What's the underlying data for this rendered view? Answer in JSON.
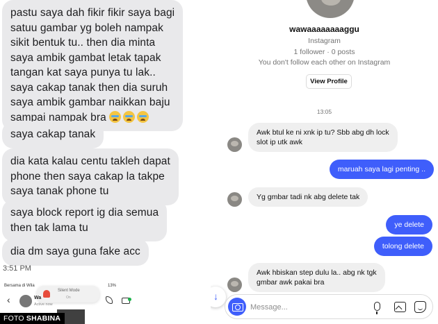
{
  "left_chat": {
    "bubbles": [
      {
        "lines": [
          "pastu saya dah fikir fikir saya bagi",
          "satuu gambar yg boleh nampak",
          "sikit bentuk tu.. then dia minta",
          "saya ambik gambat letak tapak",
          "tangan kat saya punya tu lak..",
          "saya cakap tanak then dia suruh",
          "saya ambik gambar naikkan baju",
          "sampai nampak bra"
        ]
      },
      {
        "lines": [
          "saya cakap tanak"
        ]
      },
      {
        "lines": [
          "dia kata kalau centu takleh dapat",
          "phone then saya cakap la takpe",
          "saya tanak phone tu"
        ]
      },
      {
        "lines": [
          "saya block report ig dia semua",
          "then tak lama tu"
        ]
      },
      {
        "lines": [
          "dia dm saya guna fake acc"
        ]
      }
    ],
    "emoji_count": 3,
    "time": "3:51 PM"
  },
  "phone_bar": {
    "carrier": "Bersama di Wila",
    "silent_title": "Silent Mode",
    "silent_state": "On",
    "status_right": "13%",
    "contact_name": "Wa",
    "active_status": "Active now"
  },
  "credit": {
    "prefix": "FOTO",
    "name": "SHABINA"
  },
  "profile": {
    "username": "wawaaaaaaaaggu",
    "platform": "Instagram",
    "followers": "1 follower · 0 posts",
    "follow_note": "You don't follow each other on Instagram",
    "view_profile_label": "View Profile"
  },
  "thread": {
    "timestamp": "13:05",
    "messages": [
      {
        "side": "in",
        "lines": [
          "Awk btul ke ni xnk ip tu? Sbb abg dh lock",
          "slot ip utk awk"
        ]
      },
      {
        "side": "out",
        "lines": [
          "maruah saya lagi penting .."
        ]
      },
      {
        "side": "in",
        "lines": [
          "Yg gmbar tadi nk abg delete tak"
        ]
      },
      {
        "side": "out",
        "lines": [
          "ye delete"
        ]
      },
      {
        "side": "out",
        "lines": [
          "tolong delete"
        ]
      },
      {
        "side": "in",
        "lines": [
          "Awk hbiskan step dulu la.. abg nk tgk",
          "gmbar awk pakai bra"
        ]
      }
    ]
  },
  "composer": {
    "placeholder": "Message..."
  },
  "colors": {
    "accent": "#3f5efb",
    "incoming_bubble": "#efefef",
    "sms_bubble": "#e9e9eb"
  }
}
